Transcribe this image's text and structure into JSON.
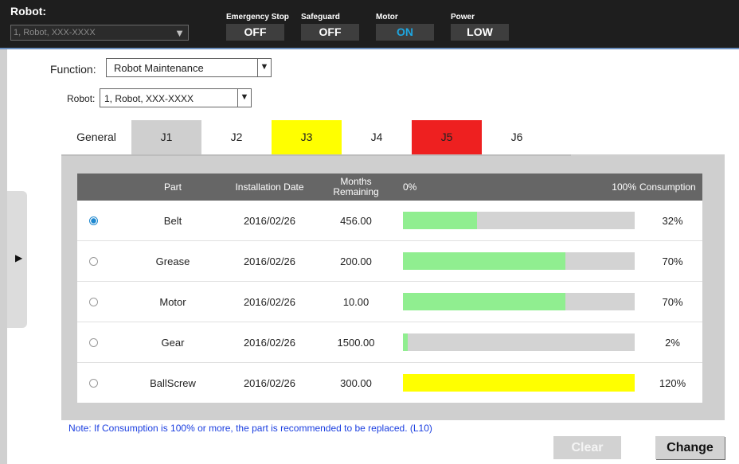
{
  "header": {
    "robot_label": "Robot:",
    "robot_value": "1, Robot, XXX-XXXX",
    "statuses": [
      {
        "label": "Emergency Stop",
        "value": "OFF"
      },
      {
        "label": "Safeguard",
        "value": "OFF"
      },
      {
        "label": "Motor",
        "value": "ON"
      },
      {
        "label": "Power",
        "value": "LOW"
      }
    ]
  },
  "selectors": {
    "function_label": "Function:",
    "function_value": "Robot Maintenance",
    "robot_label": "Robot:",
    "robot_value": "1, Robot, XXX-XXXX"
  },
  "tabs": [
    {
      "label": "General",
      "state": "normal"
    },
    {
      "label": "J1",
      "state": "active"
    },
    {
      "label": "J2",
      "state": "normal"
    },
    {
      "label": "J3",
      "state": "warning"
    },
    {
      "label": "J4",
      "state": "normal"
    },
    {
      "label": "J5",
      "state": "alert"
    },
    {
      "label": "J6",
      "state": "normal"
    }
  ],
  "table": {
    "headers": {
      "part": "Part",
      "installation_date": "Installation Date",
      "months_remaining_1": "Months",
      "months_remaining_2": "Remaining",
      "bar_min": "0%",
      "bar_max": "100%",
      "consumption": "Consumption"
    },
    "rows": [
      {
        "selected": true,
        "part": "Belt",
        "date": "2016/02/26",
        "months": "456.00",
        "consumption": "32%",
        "fraction": 0.32,
        "color": "#90ee90"
      },
      {
        "selected": false,
        "part": "Grease",
        "date": "2016/02/26",
        "months": "200.00",
        "consumption": "70%",
        "fraction": 0.7,
        "color": "#90ee90"
      },
      {
        "selected": false,
        "part": "Motor",
        "date": "2016/02/26",
        "months": "10.00",
        "consumption": "70%",
        "fraction": 0.7,
        "color": "#90ee90"
      },
      {
        "selected": false,
        "part": "Gear",
        "date": "2016/02/26",
        "months": "1500.00",
        "consumption": "2%",
        "fraction": 0.02,
        "color": "#90ee90"
      },
      {
        "selected": false,
        "part": "BallScrew",
        "date": "2016/02/26",
        "months": "300.00",
        "consumption": "120%",
        "fraction": 1.2,
        "color": "#ffff00"
      }
    ]
  },
  "footer": {
    "note": "Note: If Consumption is 100% or more, the part is recommended to be replaced. (L10)",
    "clear_label": "Clear",
    "change_label": "Change"
  }
}
